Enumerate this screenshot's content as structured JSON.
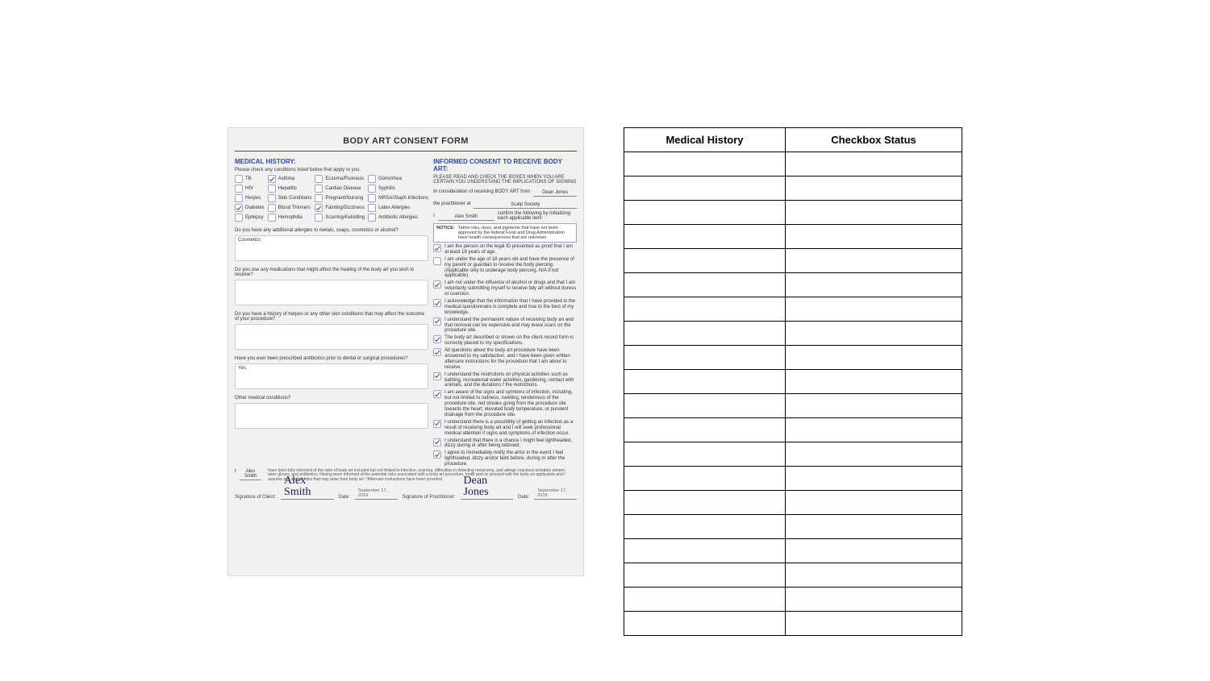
{
  "form": {
    "title": "BODY ART CONSENT FORM",
    "left": {
      "heading": "MEDICAL HISTORY:",
      "instruction": "Please check any conditions listed below that apply to you.",
      "conditions": [
        {
          "label": "TB",
          "checked": false
        },
        {
          "label": "Asthma",
          "checked": true
        },
        {
          "label": "Eczema/Psoriasis",
          "checked": false
        },
        {
          "label": "Gonorrhea",
          "checked": false
        },
        {
          "label": "HIV",
          "checked": false
        },
        {
          "label": "Hepatitis",
          "checked": false
        },
        {
          "label": "Cardiac Disease",
          "checked": false
        },
        {
          "label": "Syphilis",
          "checked": false
        },
        {
          "label": "Herpes",
          "checked": false
        },
        {
          "label": "Skin Conditions",
          "checked": false
        },
        {
          "label": "Pregnant/Nursing",
          "checked": false
        },
        {
          "label": "MRSA/Staph Infections",
          "checked": false
        },
        {
          "label": "Diabetes",
          "checked": true
        },
        {
          "label": "Blood Thinners",
          "checked": false
        },
        {
          "label": "Fainting/Dizziness",
          "checked": true
        },
        {
          "label": "Latex Allergies",
          "checked": false
        },
        {
          "label": "Epilepsy",
          "checked": false
        },
        {
          "label": "Hemophilia",
          "checked": false
        },
        {
          "label": "Scarring/Keloiding",
          "checked": false
        },
        {
          "label": "Antibiotic Allergies",
          "checked": false
        }
      ],
      "q1": "Do you have any additional allergies to metals, soaps, cosmetics or alcohol?",
      "a1": "Cosmetics",
      "q2": "Do you use any medications that might affect the healing of the body art you wish to receive?",
      "a2": "",
      "q3": "Do you have a history of herpes or any other skin conditions that may affect the outcome of your procedure?",
      "a3": "",
      "q4": "Have you ever been prescribed antibiotics prior to dental or surgical procedures?",
      "a4": "Yes.",
      "q5": "Other medical conditions?",
      "a5": ""
    },
    "right": {
      "heading": "INFORMED CONSENT TO RECEIVE BODY ART:",
      "instr": "PLEASE READ AND CHECK THE BOXES WHEN YOU ARE CERTAIN YOU UNDERSTAND THE IMPLICATIONS OF SIGNING",
      "line1_label": "In consideration of receiving BODY ART from",
      "practitioner_name": "Dean Jones",
      "line2_label": "the practitioner at",
      "studio": "Scalp Society",
      "line3_pre": "I",
      "client_name": "Alex Smith",
      "line3_post": "confirm the following by initializing each applicable item:",
      "notice_label": "NOTICE:",
      "notice_text": "Tattoo inks, dyes, and pigments that have not been approved by the federal Food and Drug Administration have health consequences that are unknown.",
      "consents": [
        {
          "checked": true,
          "text": "I am the person on the legal ID presented as proof that I am at least 18 years of age."
        },
        {
          "checked": false,
          "text": "I am under the age of 18 years old and have the presence of my parent or guardian to receive the body piercing. (Applicable only to underage body piercing. N/A if not applicable)."
        },
        {
          "checked": true,
          "text": "I am not under the influence of alcohol or drugs and that I am voluntarily submitting myself to receive bdy art without duress or coercion."
        },
        {
          "checked": true,
          "text": "I acknowledge that the information that I have provided in the medical questionnaire is complete and true to the best of my knowledge."
        },
        {
          "checked": true,
          "text": "I understand the permanent nature of receiving body art and that removal can be expensive and may leave scars on the procedure site."
        },
        {
          "checked": true,
          "text": "The body art described or shown on the client record form is correctly placed to my specifications."
        },
        {
          "checked": true,
          "text": "All questions about the body art procedure have been answered to my satisfaction, and I have been given written aftercare instructions for the procedure that I am about to receive."
        },
        {
          "checked": true,
          "text": "I understand the restrictions on physical activities such as bathing, recreational water activities, gardening, contact with animals, and the durations f the restrictions."
        },
        {
          "checked": true,
          "text": "I am aware of the signs and symtoms of infection, including, but not limited to redness, swelling, tenderness of the procedure site, red streaks going from the procedure site towards the heart, elevated body temperature, or purulent drainage from the procedure site."
        },
        {
          "checked": true,
          "text": "I understand there is a possibility of getting an infection as a result of receiving body art and I will seek professional medical attention if signs and symptoms of infection occur."
        },
        {
          "checked": true,
          "text": "I understand that there is a chance I might feel lightheaded, dizzy during or after being tattooed."
        },
        {
          "checked": true,
          "text": "I agree to immediately notify the artist in the event I feel lightheaded, dizzy and/or faint before, during or after the procedure."
        }
      ]
    },
    "decl": {
      "pre": "I",
      "name": "Alex Smith",
      "text": "have been fully informed of the risks of body art included but not limited to infection, scarring, difficulties in detecting melanoma, and allergic reactions tontattoo piment, latex gloves, and antibiotics. Having been informed of the potential risks associated with a body art procedure, Instill wish to proceed with the body art application and I assume any and all risks that may arise from body art. *Aftercare instructions have been provided."
    },
    "sig": {
      "client_label": "Signature of Client:",
      "client_sig": "Alex Smith",
      "date_label": "Date:",
      "date": "September 17, 2019",
      "prac_label": "Signature of Practitioner:",
      "prac_sig": "Dean Jones"
    }
  },
  "answer_table": {
    "headers": [
      "Medical History",
      "Checkbox Status"
    ],
    "rows": 20
  }
}
